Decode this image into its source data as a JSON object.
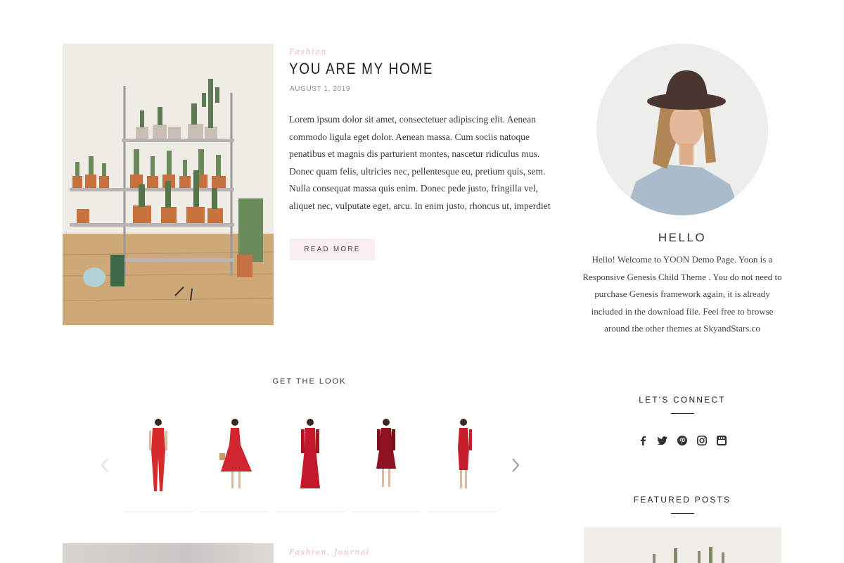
{
  "post": {
    "category": "Fashion",
    "title": "YOU ARE MY HOME",
    "date": "AUGUST 1, 2019",
    "excerpt": "Lorem ipsum dolor sit amet, consectetuer adipiscing elit. Aenean commodo ligula eget dolor. Aenean massa. Cum sociis natoque penatibus et magnis dis parturient montes, nascetur ridiculus mus. Donec quam felis, ultricies nec, pellentesque eu, pretium quis, sem. Nulla consequat massa quis enim. Donec pede justo, fringilla vel, aliquet nec, vulputate eget, arcu. In enim justo, rhoncus ut, imperdiet",
    "read_more_label": "READ MORE",
    "image_icon": "plant-shelf-photo"
  },
  "get_the_look": {
    "title": "GET THE LOOK",
    "prev_icon": "chevron-left-icon",
    "next_icon": "chevron-right-icon",
    "products": [
      {
        "icon": "red-jumpsuit",
        "color": "#d62b2b"
      },
      {
        "icon": "red-midi-dress",
        "color": "#cf2630"
      },
      {
        "icon": "red-lace-gown",
        "color": "#c2182a"
      },
      {
        "icon": "burgundy-lace-dress",
        "color": "#8e1222"
      },
      {
        "icon": "red-sheath-dress",
        "color": "#c41e2c"
      }
    ]
  },
  "post2": {
    "categories": "Fashion, Journal"
  },
  "sidebar": {
    "about": {
      "title": "HELLO",
      "text": "Hello! Welcome to YOON Demo Page. Yoon is a Responsive Genesis Child Theme . You do not need to purchase Genesis framework again, it is already included in the download file. Feel free to browse around the other themes at SkyandStars.co",
      "avatar_icon": "woman-in-hat-portrait"
    },
    "connect": {
      "title": "LET'S CONNECT",
      "icons": [
        "facebook-icon",
        "twitter-icon",
        "pinterest-icon",
        "instagram-icon",
        "youtube-icon"
      ]
    },
    "featured": {
      "title": "FEATURED POSTS"
    }
  },
  "colors": {
    "accent_pink": "#f0b6c0",
    "button_bg": "#fbeef0",
    "text": "#333333"
  }
}
